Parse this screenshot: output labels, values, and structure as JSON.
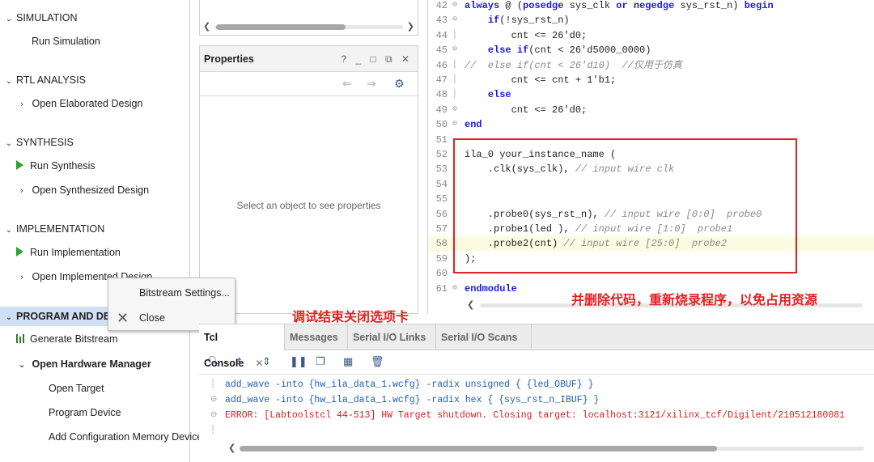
{
  "nav": {
    "simulation": {
      "title": "SIMULATION",
      "run": "Run Simulation"
    },
    "rtl": {
      "title": "RTL ANALYSIS",
      "open": "Open Elaborated Design"
    },
    "synthesis": {
      "title": "SYNTHESIS",
      "run": "Run Synthesis",
      "open": "Open Synthesized Design"
    },
    "implementation": {
      "title": "IMPLEMENTATION",
      "run": "Run Implementation",
      "open": "Open Implemented Design"
    },
    "program": {
      "title": "PROGRAM AND DE",
      "generate": "Generate Bitstream",
      "hw_manager": "Open Hardware Manager",
      "open_target": "Open Target",
      "program_device": "Program Device",
      "add_config": "Add Configuration Memory Device"
    }
  },
  "context_menu": {
    "item1": "Bitstream Settings...",
    "item2": "Close"
  },
  "properties": {
    "title": "Properties",
    "window_icons": "? _ □ ⧉ ✕",
    "empty": "Select an object to see properties"
  },
  "code": {
    "lines": [
      {
        "n": "42",
        "t": "always @ (posedge sys_clk or negedge sys_rst_n) begin"
      },
      {
        "n": "43",
        "t": "    if(!sys_rst_n)"
      },
      {
        "n": "44",
        "t": "        cnt <= 26'd0;"
      },
      {
        "n": "45",
        "t": "    else if(cnt < 26'd5000_0000)"
      },
      {
        "n": "46",
        "t": "//  else if(cnt < 26'd10)  //仅用于仿真"
      },
      {
        "n": "47",
        "t": "        cnt <= cnt + 1'b1;"
      },
      {
        "n": "48",
        "t": "    else"
      },
      {
        "n": "49",
        "t": "        cnt <= 26'd0;"
      },
      {
        "n": "50",
        "t": "end"
      },
      {
        "n": "51",
        "t": ""
      },
      {
        "n": "52",
        "t": "ila_0 your_instance_name ("
      },
      {
        "n": "53",
        "t": "    .clk(sys_clk), // input wire clk"
      },
      {
        "n": "54",
        "t": ""
      },
      {
        "n": "55",
        "t": ""
      },
      {
        "n": "56",
        "t": "    .probe0(sys_rst_n), // input wire [0:0]  probe0"
      },
      {
        "n": "57",
        "t": "    .probe1(led ), // input wire [1:0]  probe1"
      },
      {
        "n": "58",
        "t": "    .probe2(cnt) // input wire [25:0]  probe2"
      },
      {
        "n": "59",
        "t": ");"
      },
      {
        "n": "60",
        "t": ""
      },
      {
        "n": "61",
        "t": "endmodule"
      }
    ]
  },
  "annotations": {
    "close_tab": "调试结束关闭选项卡",
    "delete_code": "并删除代码，重新烧录程序，以免占用资源"
  },
  "console": {
    "tabs": [
      "Tcl Console",
      "Messages",
      "Serial I/O Links",
      "Serial I/O Scans"
    ],
    "lines": [
      "add_wave -into {hw_ila_data_1.wcfg} -radix unsigned { {led_OBUF} }",
      "add_wave -into {hw_ila_data_1.wcfg} -radix hex { {sys_rst_n_IBUF} }",
      "ERROR: [Labtoolstcl 44-513] HW Target shutdown. Closing target: localhost:3121/xilinx_tcf/Digilent/210512180081"
    ]
  },
  "colors": {
    "annotation": "#e02222",
    "keyword": "#1b1bd8",
    "selection": "#cfe0f5",
    "console_text": "#1e5eb8",
    "error": "#d12020"
  }
}
